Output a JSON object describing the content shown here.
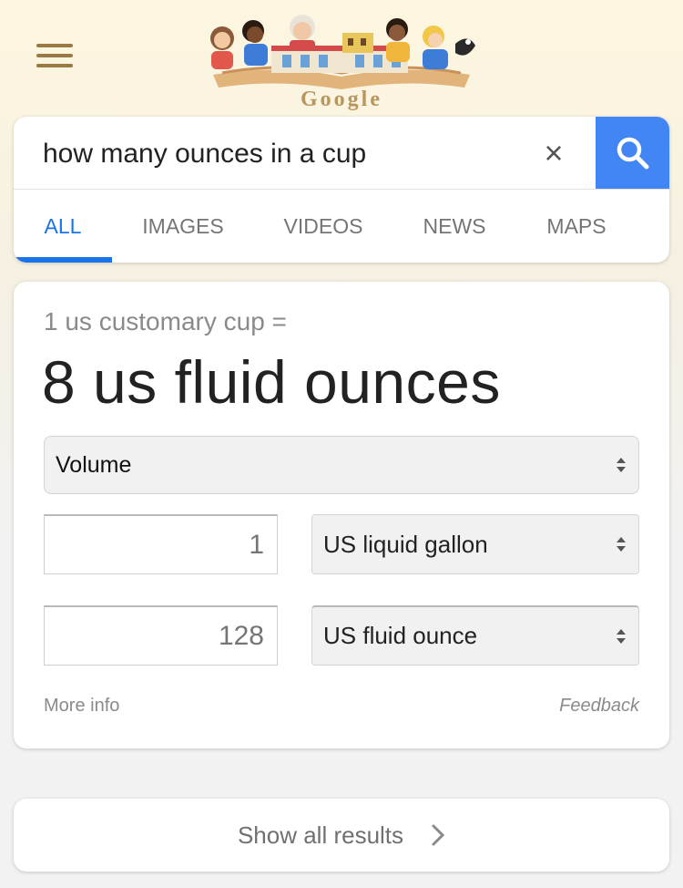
{
  "header": {
    "menu_icon": "hamburger-menu-icon",
    "doodle_text": "Google"
  },
  "search": {
    "query": "how many ounces in a cup",
    "clear_glyph": "×",
    "clear_icon": "close-icon",
    "search_icon": "magnifier-icon",
    "accent_color": "#4285f4"
  },
  "tabs": [
    {
      "label": "ALL",
      "active": true
    },
    {
      "label": "IMAGES",
      "active": false
    },
    {
      "label": "VIDEOS",
      "active": false
    },
    {
      "label": "NEWS",
      "active": false
    },
    {
      "label": "MAPS",
      "active": false
    }
  ],
  "converter": {
    "from_text": "1 us customary cup =",
    "result_text": "8 us fluid ounces",
    "quantity": "Volume",
    "from_value": "1",
    "from_unit": "US liquid gallon",
    "to_value": "128",
    "to_unit": "US fluid ounce",
    "more_info": "More info",
    "feedback": "Feedback"
  },
  "show_all": {
    "label": "Show all results",
    "icon": "chevron-right-icon"
  }
}
